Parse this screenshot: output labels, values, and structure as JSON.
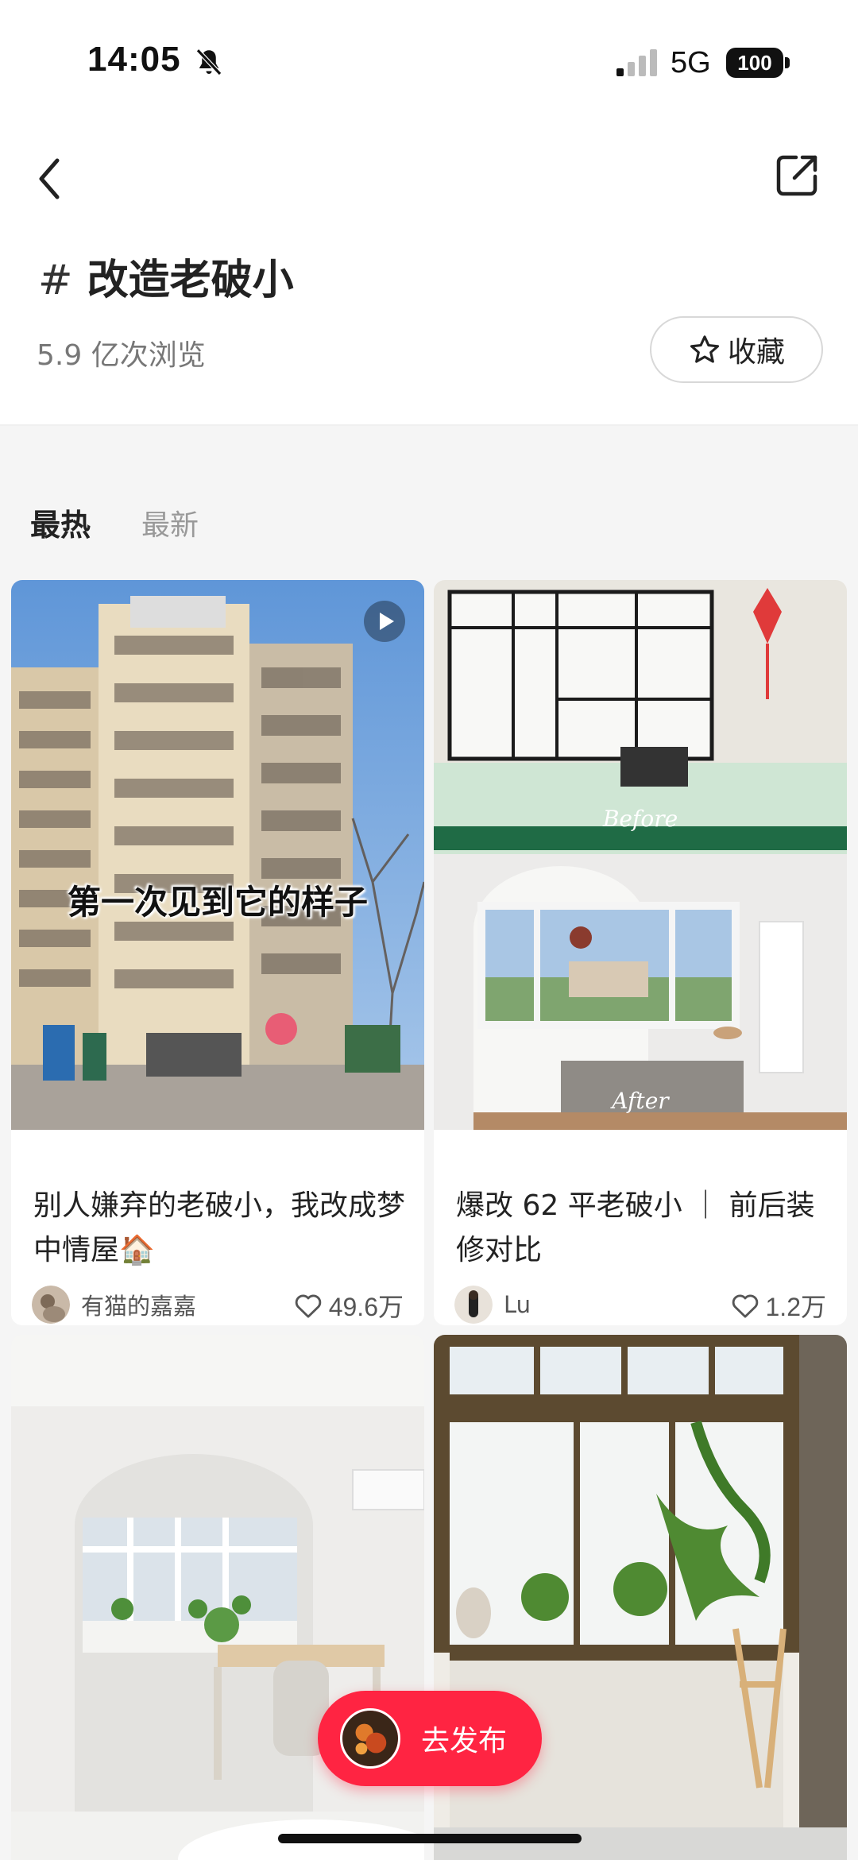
{
  "status_bar": {
    "time": "14:05",
    "network": "5G",
    "battery": "100"
  },
  "header": {
    "hash": "#",
    "title": "改造老破小",
    "views": "5.9 亿次浏览",
    "collect_label": "收藏"
  },
  "tabs": [
    {
      "label": "最热",
      "active": true
    },
    {
      "label": "最新",
      "active": false
    }
  ],
  "posts": [
    {
      "overlay_caption": "第一次见到它的样子",
      "title": "别人嫌弃的老破小，我改成梦中情屋🏠",
      "author": "有猫的嘉嘉",
      "likes": "49.6万",
      "is_video": true
    },
    {
      "before_label": "Before",
      "after_label": "After",
      "title": "爆改 62 平老破小 ｜ 前后装修对比",
      "author": "Lu",
      "likes": "1.2万"
    },
    {
      "title": ""
    },
    {
      "title": ""
    }
  ],
  "publish": {
    "label": "去发布"
  },
  "colors": {
    "accent": "#ff2442",
    "text_primary": "#222222",
    "text_secondary": "#999999",
    "feed_background": "#f5f5f5"
  },
  "icons": [
    "back-arrow-icon",
    "share-icon",
    "star-icon",
    "heart-icon",
    "play-icon",
    "bell-muted-icon",
    "signal-icon"
  ]
}
